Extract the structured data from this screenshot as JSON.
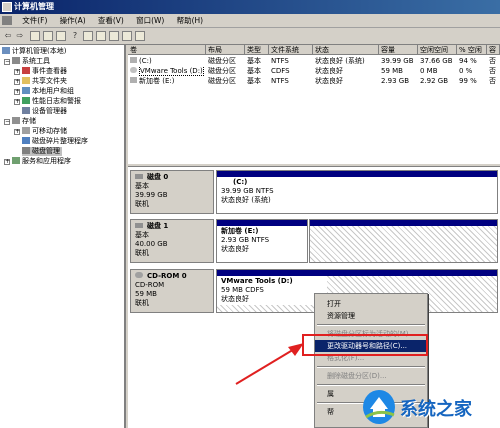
{
  "window": {
    "title": "计算机管理"
  },
  "menu": [
    {
      "label": "文件(F)"
    },
    {
      "label": "操作(A)"
    },
    {
      "label": "查看(V)"
    },
    {
      "label": "窗口(W)"
    },
    {
      "label": "帮助(H)"
    }
  ],
  "tree": {
    "root": "计算机管理(本地)",
    "system_tools": "系统工具",
    "event_viewer": "事件查看器",
    "shared_folders": "共享文件夹",
    "local_users": "本地用户和组",
    "perf_logs": "性能日志和警报",
    "device_manager": "设备管理器",
    "storage": "存储",
    "removable": "可移动存储",
    "defrag": "磁盘碎片整理程序",
    "disk_mgmt": "磁盘管理",
    "services": "服务和应用程序"
  },
  "volumes": {
    "headers": [
      "卷",
      "布局",
      "类型",
      "文件系统",
      "状态",
      "容量",
      "空闲空间",
      "% 空闲",
      "容"
    ],
    "rows": [
      [
        "(C:)",
        "磁盘分区",
        "基本",
        "NTFS",
        "状态良好 (系统)",
        "39.99 GB",
        "37.66 GB",
        "94 %",
        "否"
      ],
      [
        "VMware Tools (D:)",
        "磁盘分区",
        "基本",
        "CDFS",
        "状态良好",
        "59 MB",
        "0 MB",
        "0 %",
        "否"
      ],
      [
        "新加卷 (E:)",
        "磁盘分区",
        "基本",
        "NTFS",
        "状态良好",
        "2.93 GB",
        "2.92 GB",
        "99 %",
        "否"
      ]
    ]
  },
  "disks": [
    {
      "name": "磁盘 0",
      "type": "基本",
      "size": "39.99 GB",
      "status": "联机",
      "vol_name": "(C:)",
      "vol_info": "39.99 GB NTFS",
      "vol_status": "状态良好 (系统)"
    },
    {
      "name": "磁盘 1",
      "type": "基本",
      "size": "40.00 GB",
      "status": "联机",
      "vol_name": "新加卷 (E:)",
      "vol_info": "2.93 GB NTFS",
      "vol_status": "状态良好"
    },
    {
      "name": "CD-ROM 0",
      "type": "CD-ROM",
      "size": "59 MB",
      "status": "联机",
      "vol_name": "VMware Tools (D:)",
      "vol_info": "59 MB CDFS",
      "vol_status": "状态良好"
    }
  ],
  "context_menu": {
    "open": "打开",
    "explore": "资源管理",
    "mark_active": "将磁盘分区标为活动的(M)",
    "change_letter": "更改驱动器号和路径(C)...",
    "format": "格式化(F)...",
    "delete": "删除磁盘分区(D)...",
    "properties": "属",
    "help": "帮"
  },
  "watermark": {
    "text": "系统之家"
  },
  "colors": {
    "highlight": "#0a246a",
    "annotation": "#e02020",
    "disk_bar": "#000080"
  }
}
